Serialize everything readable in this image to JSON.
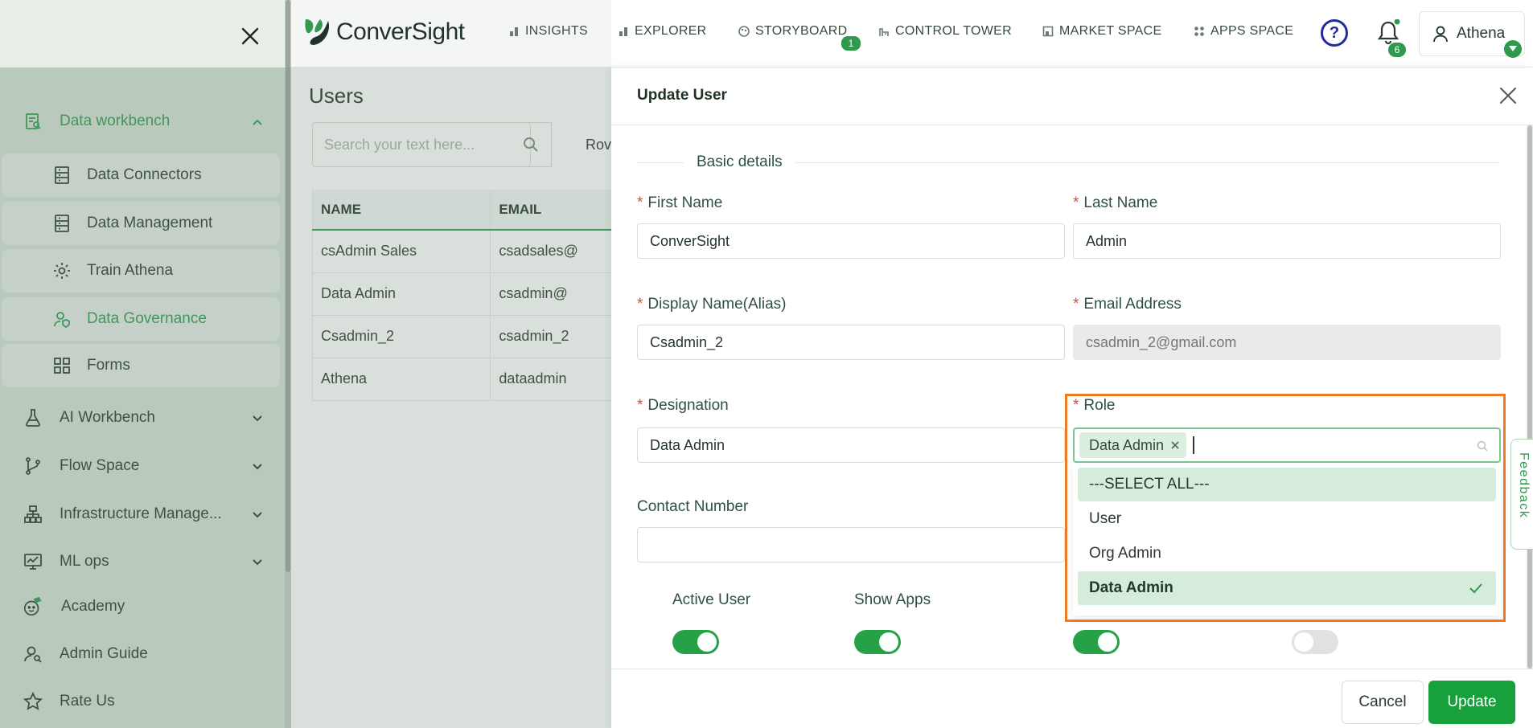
{
  "colors": {
    "brand": "#2f9a4e",
    "highlight": "#f07b24",
    "update_button": "#17a03c"
  },
  "brand": {
    "name": "ConverSight"
  },
  "sidebar": {
    "groups": [
      {
        "label": "Data workbench",
        "icon": "data-workbench-icon",
        "expanded": true
      },
      {
        "label": "AI Workbench",
        "icon": "flask-icon"
      },
      {
        "label": "Flow Space",
        "icon": "git-branch-icon"
      },
      {
        "label": "Infrastructure Manage...",
        "icon": "sitemap-icon"
      },
      {
        "label": "ML ops",
        "icon": "chart-monitor-icon"
      },
      {
        "label": "Academy",
        "icon": "academy-icon"
      },
      {
        "label": "Admin Guide",
        "icon": "user-search-icon"
      },
      {
        "label": "Rate Us",
        "icon": "star-icon"
      }
    ],
    "sub_items": [
      {
        "label": "Data Connectors",
        "icon": "server-icon"
      },
      {
        "label": "Data Management",
        "icon": "server-icon"
      },
      {
        "label": "Train Athena",
        "icon": "gear-icon"
      },
      {
        "label": "Data Governance",
        "icon": "user-shield-icon",
        "active": true
      },
      {
        "label": "Forms",
        "icon": "grid-icon"
      }
    ]
  },
  "topnav": {
    "items": [
      {
        "label": "INSIGHTS",
        "icon": "bar-chart-icon"
      },
      {
        "label": "EXPLORER",
        "icon": "bar-chart-icon"
      },
      {
        "label": "STORYBOARD",
        "icon": "palette-icon",
        "badge": "1"
      },
      {
        "label": "CONTROL TOWER",
        "icon": "tower-icon"
      },
      {
        "label": "MARKET SPACE",
        "icon": "store-icon"
      },
      {
        "label": "APPS SPACE",
        "icon": "apps-icon"
      }
    ],
    "notifications_badge": "6",
    "user_name": "Athena"
  },
  "users_page": {
    "title": "Users",
    "search_placeholder": "Search your text here...",
    "rows_label": "Rov",
    "columns": [
      "NAME",
      "EMAIL"
    ],
    "rows": [
      [
        "csAdmin Sales",
        "csadsales@"
      ],
      [
        "Data Admin",
        "csadmin@"
      ],
      [
        "Csadmin_2",
        "csadmin_2"
      ],
      [
        "Athena",
        "dataadmin"
      ]
    ]
  },
  "drawer": {
    "title": "Update User",
    "section": "Basic details",
    "fields": {
      "first_name": {
        "label": "First Name",
        "value": "ConverSight"
      },
      "last_name": {
        "label": "Last Name",
        "value": "Admin"
      },
      "display_name": {
        "label": "Display Name(Alias)",
        "value": "Csadmin_2"
      },
      "email": {
        "label": "Email Address",
        "placeholder": "csadmin_2@gmail.com"
      },
      "designation": {
        "label": "Designation",
        "value": "Data Admin"
      },
      "role": {
        "label": "Role",
        "selected_chip": "Data Admin"
      },
      "contact": {
        "label": "Contact Number",
        "value": ""
      }
    },
    "role_options": [
      {
        "label": "---SELECT ALL---",
        "state": "highlighted"
      },
      {
        "label": "User",
        "state": "normal"
      },
      {
        "label": "Org Admin",
        "state": "normal"
      },
      {
        "label": "Data Admin",
        "state": "selected"
      }
    ],
    "toggles": [
      {
        "label": "Active User",
        "on": true
      },
      {
        "label": "Show Apps",
        "on": true
      },
      {
        "label": "",
        "on": true
      },
      {
        "label": "",
        "on": false
      }
    ],
    "cancel_label": "Cancel",
    "update_label": "Update"
  },
  "feedback_label": "Feedback"
}
